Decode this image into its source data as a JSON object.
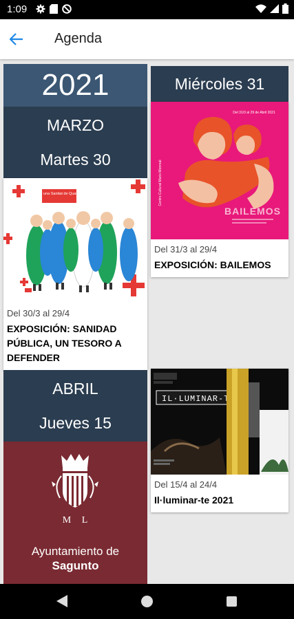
{
  "status_bar": {
    "time": "1:09"
  },
  "app_bar": {
    "title": "Agenda"
  },
  "left_column": {
    "year": "2021",
    "groups": [
      {
        "month": "MARZO",
        "day": "Martes 30",
        "event": {
          "dates": "Del 30/3 al 29/4",
          "title_lines": [
            "EXPOSICIÓN: SANIDAD",
            "PÚBLICA, UN TESORO A",
            "DEFENDER"
          ],
          "poster_banner": "Per una Sanitat de Qualitat"
        }
      },
      {
        "month": "ABRIL",
        "day": "Jueves 15",
        "institution_line1": "Ayuntamiento de",
        "institution_line2": "Sagunto",
        "crest_letters": [
          "M",
          "L"
        ]
      }
    ]
  },
  "right_column": {
    "day": "Miércoles 31",
    "events": [
      {
        "dates": "Del 31/3 al 29/4",
        "title": "EXPOSICIÓN: BAILEMOS",
        "poster_word": "BAILEMOS",
        "poster_date": "Del 31/3 al 29 de Abril 2021",
        "poster_side": "Centro Cultural Mario Monreal"
      },
      {
        "dates": "Del 15/4 al 24/4",
        "title": "Il·luminar-te 2021",
        "poster_word": "IL·LUMINAR-TE"
      }
    ]
  },
  "colors": {
    "year_bg": "#3b5773",
    "header_bg": "#2b3d50",
    "maroon": "#7a2a32",
    "accent": "#1e88e5"
  }
}
